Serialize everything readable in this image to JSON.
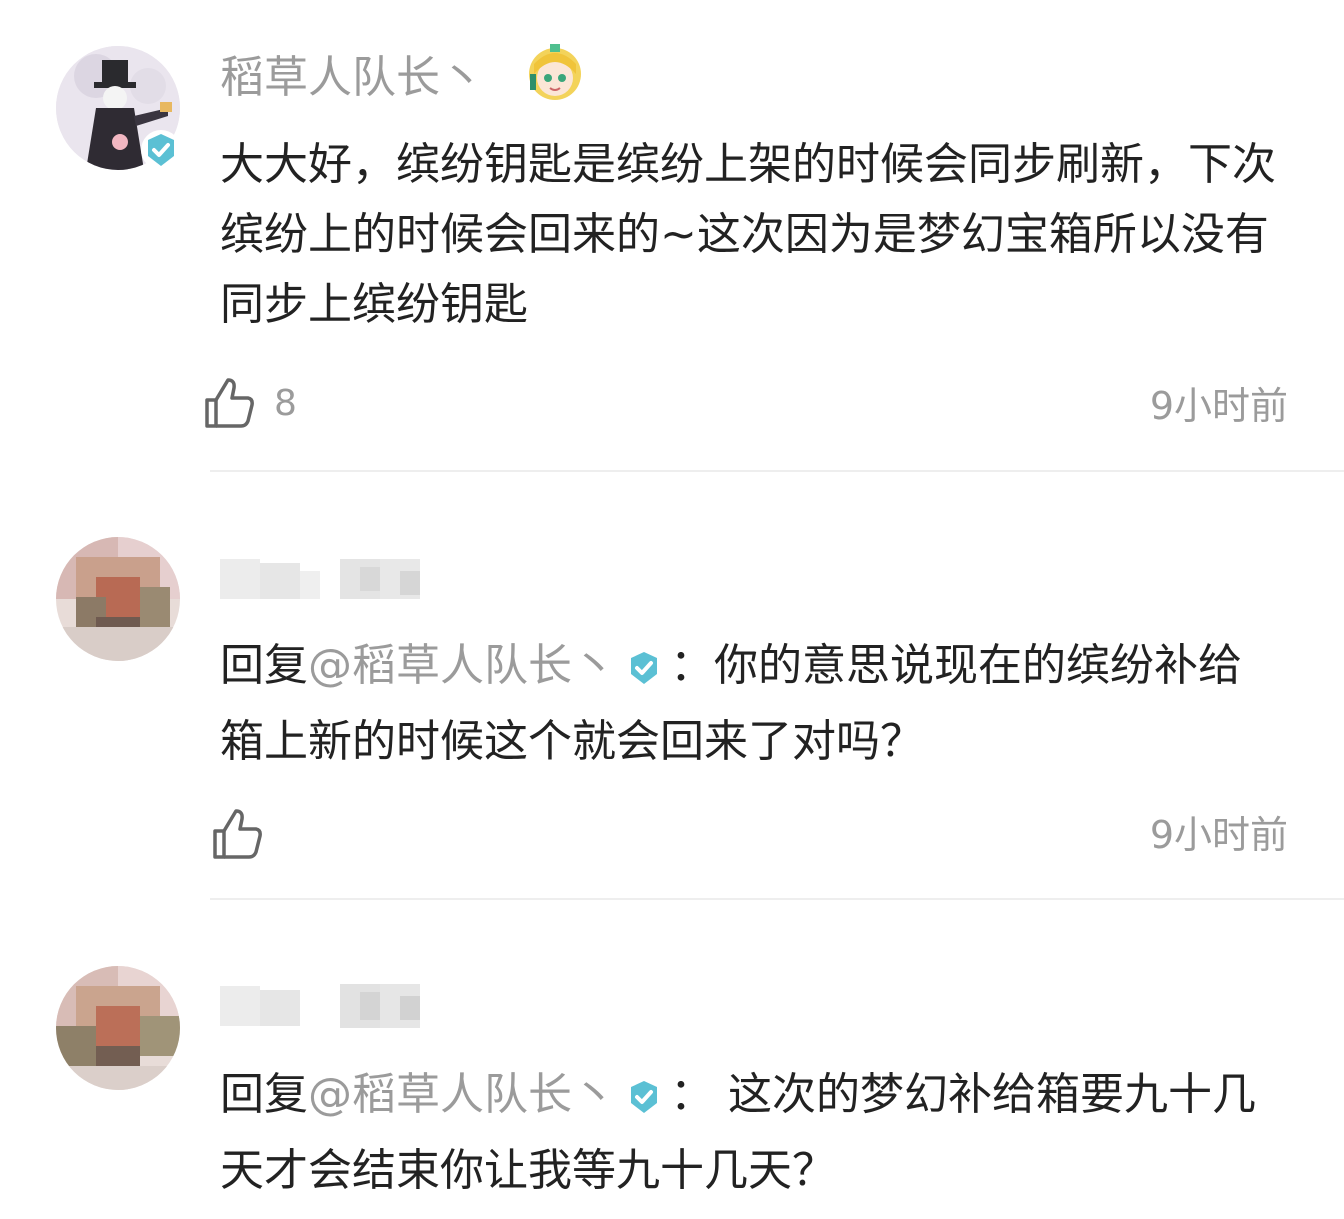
{
  "comments": [
    {
      "username": "稻草人队长丶",
      "text": "大大好，缤纷钥匙是缤纷上架的时候会同步刷新，下次缤纷上的时候会回来的~这次因为是梦幻宝箱所以没有同步上缤纷钥匙",
      "likes": "8",
      "time": "9小时前",
      "avatar_icon": "scarecrow-avatar",
      "badge_icon": "anime-girl-badge-icon"
    },
    {
      "reply_prefix": "回复",
      "mention": "@稻草人队长丶",
      "colon": "：",
      "text": "你的意思说现在的缤纷补给箱上新的时候这个就会回来了对吗？",
      "time": "9小时前",
      "avatar_icon": "pixelated-avatar"
    },
    {
      "reply_prefix": "回复",
      "mention": "@稻草人队长丶",
      "colon": "：",
      "text": " 这次的梦幻补给箱要九十几天才会结束你让我等九十几天？",
      "avatar_icon": "pixelated-avatar"
    }
  ],
  "colors": {
    "verified": "#5bc0d4",
    "muted": "#9b9b9b",
    "text": "#222222"
  }
}
